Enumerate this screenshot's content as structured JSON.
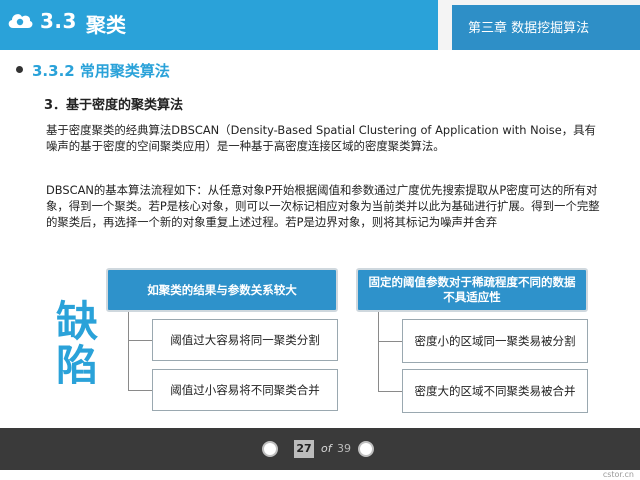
{
  "header": {
    "section_number": "3.3",
    "section_title": "聚类",
    "chapter": "第三章 数据挖掘算法"
  },
  "subsection": {
    "title": "3.3.2 常用聚类算法"
  },
  "item": {
    "title": "3．基于密度的聚类算法"
  },
  "paragraphs": {
    "p1": "基于密度聚类的经典算法DBSCAN（Density-Based Spatial Clustering of Application with Noise，具有噪声的基于密度的空间聚类应用）是一种基于高密度连接区域的密度聚类算法。",
    "p2": "DBSCAN的基本算法流程如下：从任意对象P开始根据阈值和参数通过广度优先搜索提取从P密度可达的所有对象，得到一个聚类。若P是核心对象，则可以一次标记相应对象为当前类并以此为基础进行扩展。得到一个完整的聚类后，再选择一个新的对象重复上述过程。若P是边界对象，则将其标记为噪声并舍弃"
  },
  "defect_label": {
    "char1": "缺",
    "char2": "陷"
  },
  "left_group": {
    "heading": "如聚类的结果与参数关系较大",
    "items": [
      "阈值过大容易将同一聚类分割",
      "阈值过小容易将不同聚类合并"
    ]
  },
  "right_group": {
    "heading": "固定的阈值参数对于稀疏程度不同的数据不具适应性",
    "items": [
      "密度小的区域同一聚类易被分割",
      "密度大的区域不同聚类易被合并"
    ]
  },
  "footer": {
    "current_page": "27",
    "of_label": "of",
    "total_pages": "39"
  },
  "watermark": "cstor.cn",
  "colors": {
    "accent": "#2aa2d9",
    "chapter_bg": "#2e8fc7",
    "footer_bg": "#3a3a3a"
  }
}
